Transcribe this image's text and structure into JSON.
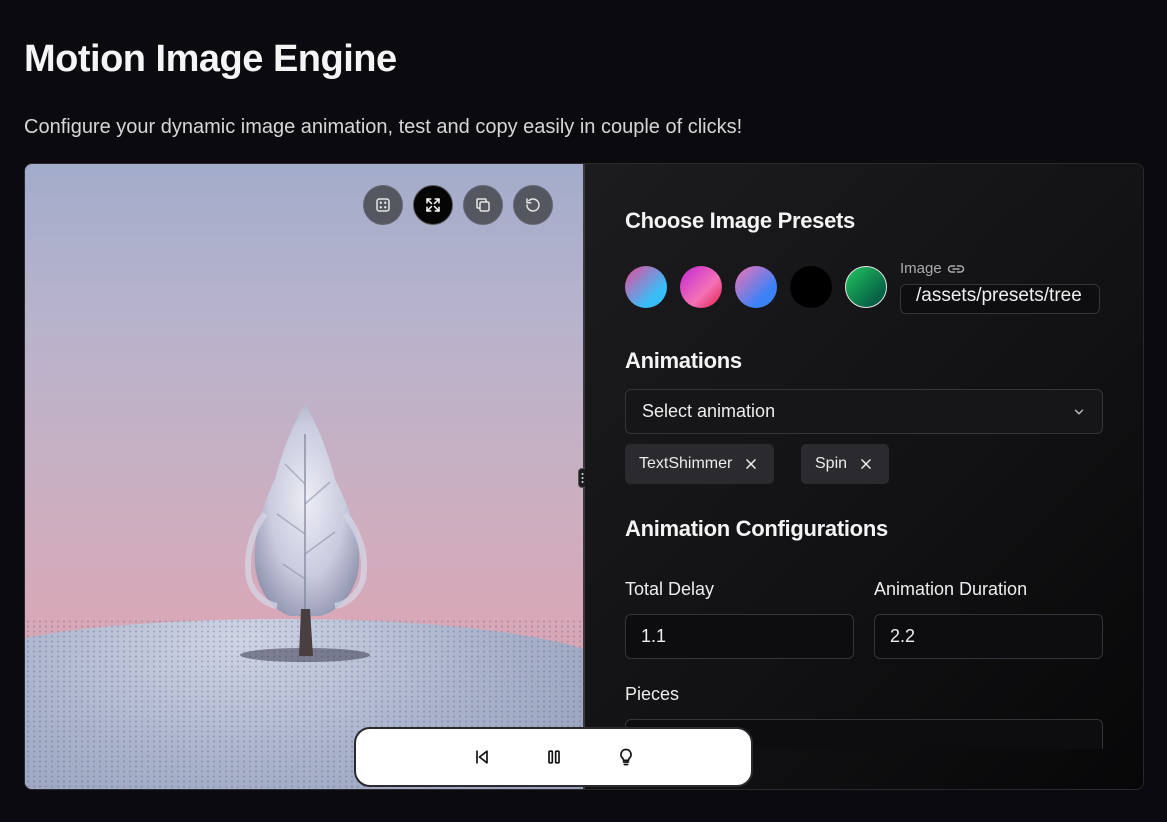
{
  "header": {
    "title": "Motion Image Engine",
    "subtitle": "Configure your dynamic image animation, test and copy easily in couple of clicks!"
  },
  "preview": {
    "tools": [
      {
        "name": "dice-icon",
        "active": false
      },
      {
        "name": "fullscreen-icon",
        "active": true
      },
      {
        "name": "copy-icon",
        "active": false
      },
      {
        "name": "reset-icon",
        "active": false
      }
    ]
  },
  "presets": {
    "title": "Choose Image Presets",
    "swatches": [
      {
        "name": "preset-blue-pink",
        "gradient": [
          "#ec4899",
          "#38bdf8"
        ]
      },
      {
        "name": "preset-pink-purple",
        "gradient": [
          "#f472b6",
          "#c026d3"
        ]
      },
      {
        "name": "preset-pink-blue",
        "gradient": [
          "#f472b6",
          "#3b82f6"
        ]
      },
      {
        "name": "preset-black",
        "gradient": [
          "#000000",
          "#000000"
        ]
      },
      {
        "name": "preset-green",
        "gradient": [
          "#16a34a",
          "#064e3b"
        ]
      }
    ],
    "image_label": "Image",
    "image_value": "/assets/presets/tree"
  },
  "animations": {
    "title": "Animations",
    "select_placeholder": "Select animation",
    "chips": [
      "TextShimmer",
      "Spin"
    ]
  },
  "config": {
    "title": "Animation Configurations",
    "total_delay_label": "Total Delay",
    "total_delay_value": "1.1",
    "duration_label": "Animation Duration",
    "duration_value": "2.2",
    "pieces_label": "Pieces",
    "pieces_value": ""
  },
  "colors": {
    "background": "#0b0b0f",
    "panel": "#131316",
    "chip": "#2b2b2f",
    "accent_white": "#ffffff"
  }
}
